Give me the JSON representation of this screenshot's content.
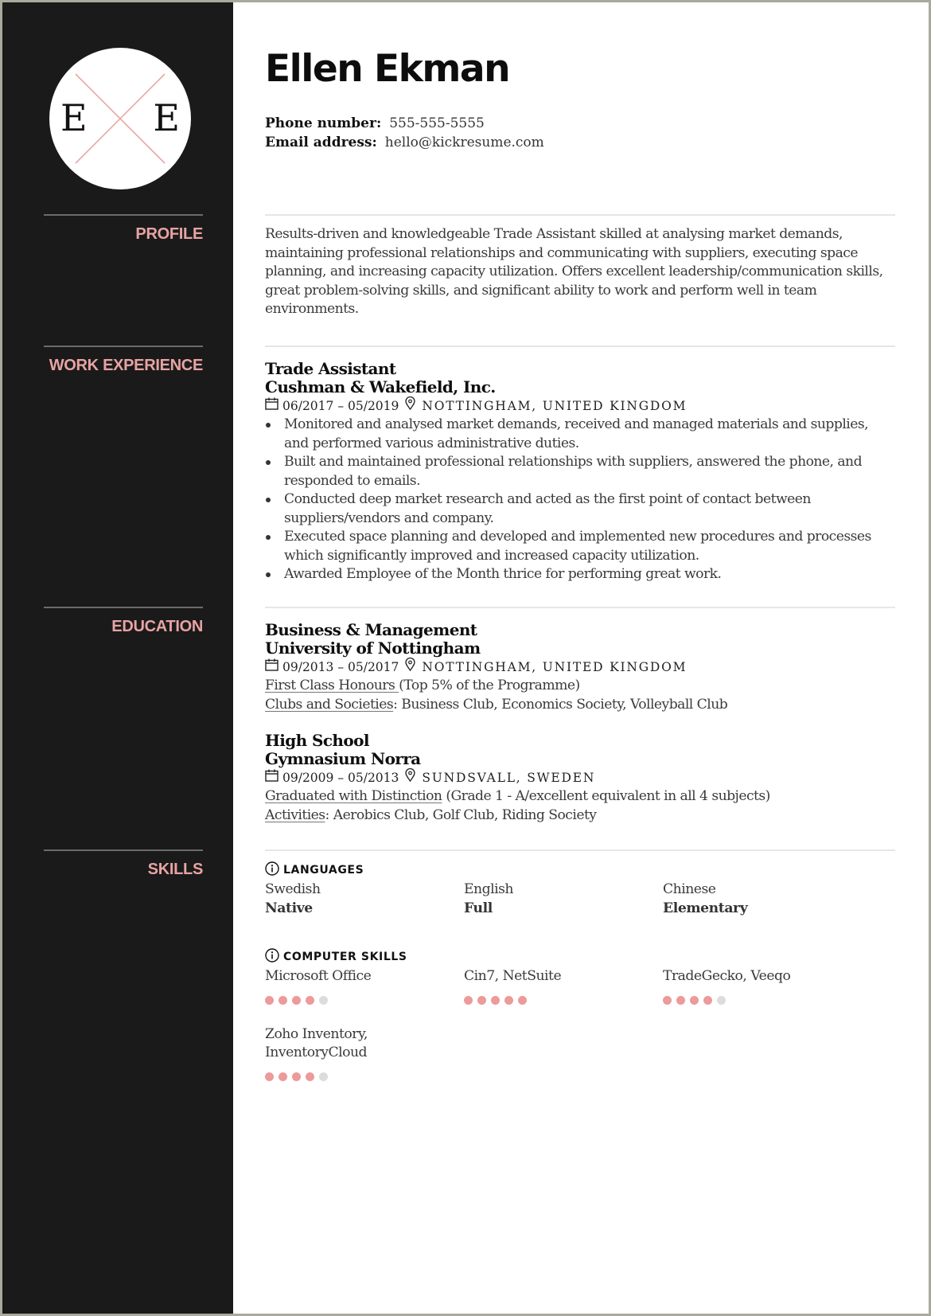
{
  "monogram": {
    "left": "E",
    "right": "E"
  },
  "header": {
    "name": "Ellen Ekman",
    "phone_label": "Phone number:",
    "phone": "555-555-5555",
    "email_label": "Email address:",
    "email": "hello@kickresume.com"
  },
  "colors": {
    "sidebar": "#1a1a1a",
    "accent": "#e8a3a3",
    "dot_on": "#ec9a9a",
    "dot_off": "#dcdcdc"
  },
  "sections": {
    "profile": "PROFILE",
    "work": "WORK EXPERIENCE",
    "education": "EDUCATION",
    "skills": "SKILLS"
  },
  "profile": {
    "text": "Results-driven and knowledgeable Trade Assistant skilled at analysing market demands, maintaining professional relationships and communicating with suppliers, executing space planning, and increasing capacity utilization. Offers excellent leadership/communication skills, great problem-solving skills, and significant ability to work and perform well in team environments."
  },
  "work": [
    {
      "title": "Trade Assistant",
      "company": "Cushman & Wakefield, Inc.",
      "dates": "06/2017 – 05/2019",
      "location": "Nottingham, United Kingdom",
      "bullets": [
        "Monitored and analysed market demands, received and managed materials and supplies, and performed various administrative duties.",
        "Built and maintained professional relationships with suppliers, answered the phone, and responded to emails.",
        "Conducted deep market research and acted as the first point of contact between suppliers/vendors and company.",
        "Executed space planning and developed and implemented new procedures and processes which significantly improved and increased capacity utilization.",
        "Awarded Employee of the Month thrice for performing great work."
      ]
    }
  ],
  "education": [
    {
      "degree": "Business & Management",
      "school": "University of Nottingham",
      "dates": "09/2013 – 05/2017",
      "location": "Nottingham, United Kingdom",
      "line1_u": "First Class Honours ",
      "line1_rest": "(Top 5% of the Programme)",
      "line2_u": "Clubs and Societies",
      "line2_rest": ": Business Club, Economics Society, Volleyball Club"
    },
    {
      "degree": "High School",
      "school": "Gymnasium Norra",
      "dates": "09/2009 – 05/2013",
      "location": "Sundsvall, Sweden",
      "line1_u": "Graduated with Distinction",
      "line1_rest": " (Grade 1 - A/excellent equivalent in all 4 subjects)",
      "line2_u": "Activities",
      "line2_rest": ": Aerobics Club, Golf Club, Riding Society"
    }
  ],
  "skills": {
    "languages_title": "LANGUAGES",
    "languages": [
      {
        "name": "Swedish",
        "level": "Native"
      },
      {
        "name": "English",
        "level": "Full"
      },
      {
        "name": "Chinese",
        "level": "Elementary"
      }
    ],
    "computer_title": "COMPUTER SKILLS",
    "computer": [
      {
        "name": "Microsoft Office",
        "rating": 4,
        "max": 5
      },
      {
        "name": "Cin7, NetSuite",
        "rating": 5,
        "max": 5
      },
      {
        "name": "TradeGecko, Veeqo",
        "rating": 4,
        "max": 5
      },
      {
        "name": "Zoho Inventory, InventoryCloud",
        "rating": 4,
        "max": 5
      }
    ]
  },
  "icons": {
    "date": "calendar-icon",
    "location": "map-pin-icon",
    "info": "info-circle-icon"
  }
}
